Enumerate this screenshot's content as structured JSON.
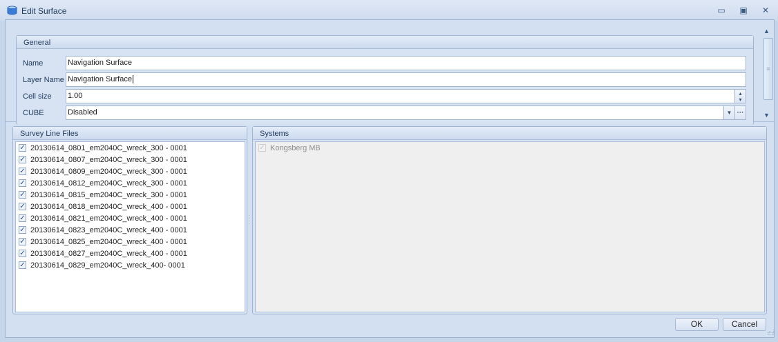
{
  "window": {
    "title": "Edit Surface",
    "minimize": "▭",
    "maximize": "▣",
    "close": "✕"
  },
  "general": {
    "header": "General",
    "name_label": "Name",
    "name_value": "Navigation Surface",
    "layer_label": "Layer Name",
    "layer_value": "Navigation Surface",
    "cell_label": "Cell size",
    "cell_value": "1.00",
    "cube_label": "CUBE",
    "cube_value": "Disabled",
    "ellipsis": "···"
  },
  "survey": {
    "header": "Survey Line Files",
    "items": [
      {
        "label": "20130614_0801_em2040C_wreck_300 - 0001",
        "checked": true
      },
      {
        "label": "20130614_0807_em2040C_wreck_300 - 0001",
        "checked": true
      },
      {
        "label": "20130614_0809_em2040C_wreck_300 - 0001",
        "checked": true
      },
      {
        "label": "20130614_0812_em2040C_wreck_300 - 0001",
        "checked": true
      },
      {
        "label": "20130614_0815_em2040C_wreck_300 - 0001",
        "checked": true
      },
      {
        "label": "20130614_0818_em2040C_wreck_400 - 0001",
        "checked": true
      },
      {
        "label": "20130614_0821_em2040C_wreck_400 - 0001",
        "checked": true
      },
      {
        "label": "20130614_0823_em2040C_wreck_400 - 0001",
        "checked": true
      },
      {
        "label": "20130614_0825_em2040C_wreck_400 - 0001",
        "checked": true
      },
      {
        "label": "20130614_0827_em2040C_wreck_400 - 0001",
        "checked": true
      },
      {
        "label": "20130614_0829_em2040C_wreck_400- 0001",
        "checked": true
      }
    ]
  },
  "systems": {
    "header": "Systems",
    "items": [
      {
        "label": "Kongsberg MB",
        "checked": true,
        "disabled": true
      }
    ]
  },
  "buttons": {
    "ok": "OK",
    "cancel": "Cancel"
  }
}
